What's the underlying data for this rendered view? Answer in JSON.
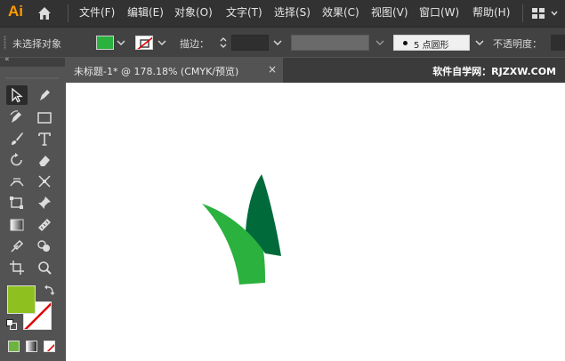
{
  "app": {
    "logo": "Ai"
  },
  "menu": {
    "items": [
      "文件(F)",
      "编辑(E)",
      "对象(O)",
      "文字(T)",
      "选择(S)",
      "效果(C)",
      "视图(V)",
      "窗口(W)",
      "帮助(H)"
    ]
  },
  "control_bar": {
    "selection_status": "未选择对象",
    "fill_color": "#2ab13e",
    "stroke_label": "描边：",
    "brush_label": "5 点圆形",
    "opacity_label": "不透明度："
  },
  "document": {
    "tab_title": "未标题-1* @ 178.18% (CMYK/预览)",
    "close_glyph": "×",
    "watermark": "软件自学网：RJZXW.COM"
  },
  "toolbox": {
    "collapse_glyph": "«",
    "tools": [
      "selection-tool",
      "direct-selection-tool",
      "pen-tool",
      "rectangle-tool",
      "paintbrush-tool",
      "type-tool",
      "rotate-tool",
      "eraser-tool",
      "width-tool",
      "puppet-warp-tool",
      "free-transform-tool",
      "pin-tool",
      "gradient-tool",
      "ruler-tool",
      "eyedropper-tool",
      "shape-builder-tool",
      "artboard-tool",
      "zoom-tool"
    ],
    "fill_color": "#8ec11f"
  },
  "artwork": {
    "dark_leaf_color": "#006a3a",
    "light_leaf_color": "#2ab13e"
  }
}
